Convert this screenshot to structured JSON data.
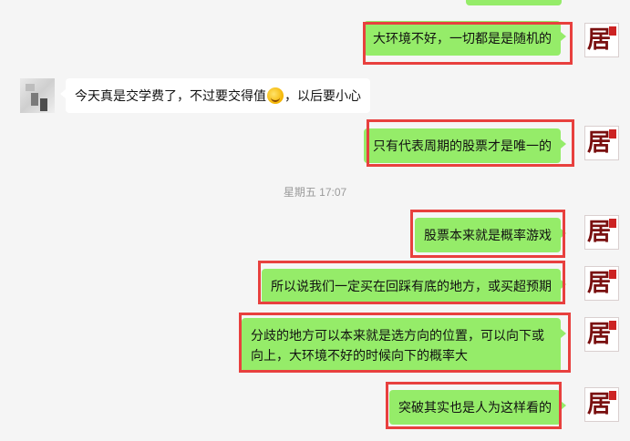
{
  "chat": {
    "timestamp": "星期五 17:07",
    "messages": [
      {
        "sender": "me",
        "text": "大环境不好，一切都是是随机的"
      },
      {
        "sender": "other",
        "text_before": "今天真是交学费了，不过要交得值",
        "emoji": "grin-sweat-emoji",
        "text_after": "，以后要小心"
      },
      {
        "sender": "me",
        "text": "只有代表周期的股票才是唯一的"
      },
      {
        "sender": "me",
        "text": "股票本来就是概率游戏"
      },
      {
        "sender": "me",
        "text": "所以说我们一定买在回踩有底的地方，或买超预期"
      },
      {
        "sender": "me",
        "text": "分歧的地方可以本来就是选方向的位置，可以向下或向上，大环境不好的时候向下的概率大"
      },
      {
        "sender": "me",
        "text": "突破其实也是人为这样看的"
      }
    ]
  },
  "avatar_me": {
    "glyph": "居"
  },
  "colors": {
    "outgoing_bubble": "#95ec69",
    "incoming_bubble": "#ffffff",
    "highlight_box": "#e8403e",
    "background": "#f5f5f5"
  }
}
